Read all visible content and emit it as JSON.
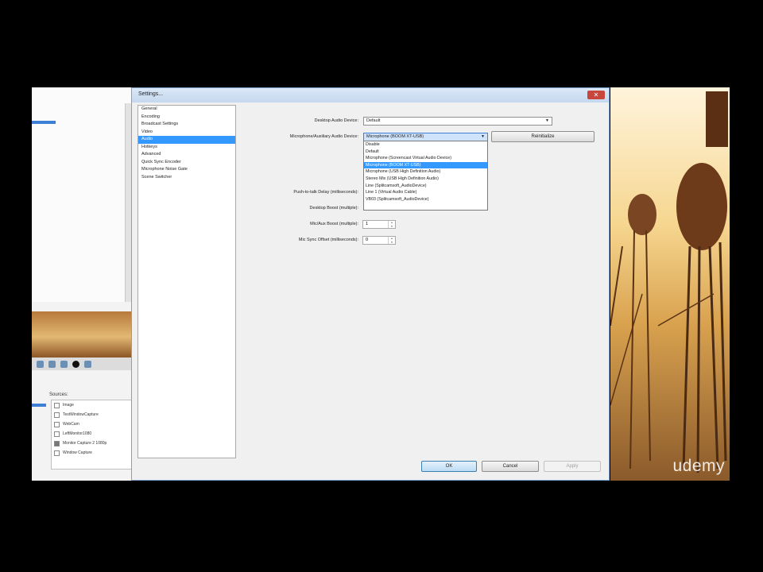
{
  "background_app": {
    "labels": [
      "",
      "",
      "",
      "",
      "",
      "",
      ""
    ],
    "sources_title": "Sources:",
    "sources": [
      {
        "label": "Image",
        "checked": false
      },
      {
        "label": "TestWindowCapture",
        "checked": false
      },
      {
        "label": "WebCam",
        "checked": false
      },
      {
        "label": "LeftMonitor1080",
        "checked": false
      },
      {
        "label": "Monitor Capture 2 1080p",
        "checked": true
      },
      {
        "label": "Window Capture",
        "checked": false
      }
    ]
  },
  "settings": {
    "title": "Settings...",
    "close_glyph": "✕",
    "categories": [
      "General",
      "Encoding",
      "Broadcast Settings",
      "Video",
      "Audio",
      "Hotkeys",
      "Advanced",
      "Quick Sync Encoder",
      "Microphone Noise Gate",
      "Scene Switcher"
    ],
    "selected_category": "Audio",
    "desktop_audio_label": "Desktop Audio Device:",
    "desktop_audio_value": "Default",
    "mic_label": "Microphone/Auxiliary Audio Device:",
    "mic_value": "Microphone (BOOM XT-USB)",
    "reinit_button": "Reinitialize",
    "ptt_delay_label": "Push-to-talk Delay (milliseconds):",
    "desktop_boost_label": "Desktop Boost (multiple):",
    "mic_boost_label": "Mic/Aux Boost (multiple):",
    "mic_boost_value": "1",
    "mic_sync_label": "Mic Sync Offset (milliseconds):",
    "mic_sync_value": "0",
    "dropdown_options": [
      "Disable",
      "Default",
      "Microphone (Screencast Virtual Audio Device)",
      "Microphone (BOOM XT-USB)",
      "Microphone (USB High Definition Audio)",
      "Stereo Mix (USB High Definition Audio)",
      "Line (Splitcamsoft_AudioDevice)",
      "Line 1 (Virtual Audio Cable)",
      "VB03 (Splitcamsoft_AudioDevice)"
    ],
    "highlighted_option": "Microphone (BOOM XT-USB)",
    "ok_button": "OK",
    "cancel_button": "Cancel",
    "apply_button": "Apply"
  },
  "watermark": "udemy",
  "colors": {
    "selection": "#3399ff",
    "close": "#c9463d"
  }
}
